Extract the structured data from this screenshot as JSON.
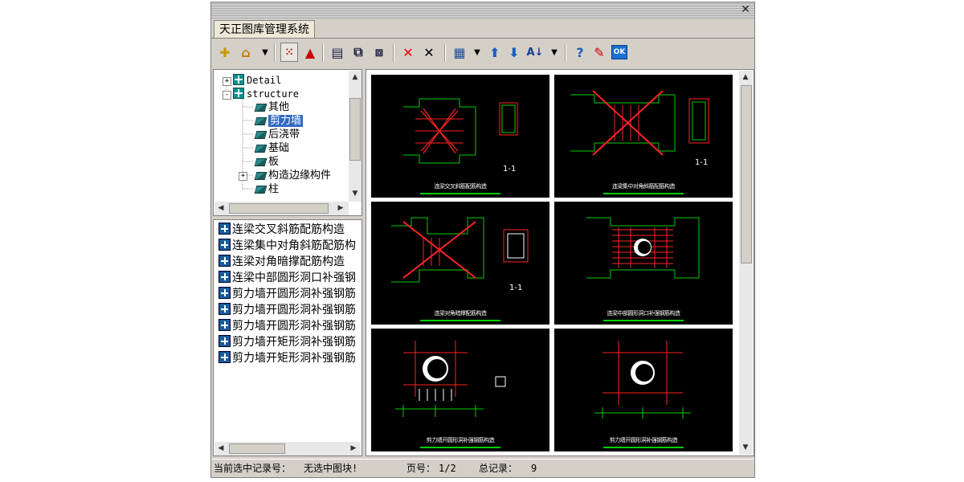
{
  "window": {
    "close_glyph": "✕",
    "tab_title": "天正图库管理系统"
  },
  "toolbar": {
    "icons": [
      "new-library-icon",
      "open-library-icon",
      "dropdown-arrow-icon",
      "select-all-icon",
      "triangle-view-icon",
      "list-view-icon",
      "export-icon",
      "import-icon",
      "delete-red-icon",
      "delete-black-icon",
      "grid-layout-icon",
      "dropdown-arrow-icon",
      "move-up-icon",
      "move-down-icon",
      "sort-az-icon",
      "dropdown-arrow-icon",
      "help-icon",
      "edit-icon",
      "ok-icon"
    ],
    "ok_label": "OK"
  },
  "tree": {
    "items": [
      {
        "label": "Detail",
        "level": 0,
        "expander": "+",
        "icon": "structure-icon"
      },
      {
        "label": "structure",
        "level": 0,
        "expander": "-",
        "icon": "structure-icon"
      },
      {
        "label": "其他",
        "level": 1,
        "icon": "book-icon"
      },
      {
        "label": "剪力墙",
        "level": 1,
        "icon": "open-book-icon",
        "selected": true
      },
      {
        "label": "后浇带",
        "level": 1,
        "icon": "book-icon"
      },
      {
        "label": "基础",
        "level": 1,
        "icon": "book-icon"
      },
      {
        "label": "板",
        "level": 1,
        "icon": "book-icon"
      },
      {
        "label": "构造边缘构件",
        "level": 1,
        "expander": "+",
        "icon": "book-icon"
      },
      {
        "label": "柱",
        "level": 1,
        "icon": "book-icon"
      }
    ]
  },
  "list": {
    "items": [
      "连梁交叉斜筋配筋构造",
      "连梁集中对角斜筋配筋构",
      "连梁对角暗撑配筋构造",
      "连梁中部圆形洞口补强钢",
      "剪力墙开圆形洞补强钢筋",
      "剪力墙开圆形洞补强钢筋",
      "剪力墙开圆形洞补强钢筋",
      "剪力墙开矩形洞补强钢筋",
      "剪力墙开矩形洞补强钢筋"
    ]
  },
  "preview": {
    "thumbnails": [
      {
        "caption": "连梁交叉斜筋配筋构造",
        "section_label": "1-1"
      },
      {
        "caption": "连梁集中对角斜筋配筋构造",
        "section_label": "1-1"
      },
      {
        "caption": "连梁对角暗撑配筋构造",
        "section_label": "1-1"
      },
      {
        "caption": "连梁中部圆形洞口补强钢筋构造",
        "section_label": ""
      },
      {
        "caption": "剪力墙开圆形洞补强钢筋构造",
        "section_label": ""
      },
      {
        "caption": "剪力墙开圆形洞补强钢筋构造",
        "section_label": ""
      }
    ],
    "colors": {
      "bg": "#000000",
      "red": "#ff2020",
      "green": "#00e000",
      "white": "#ffffff",
      "yellow": "#ffff00"
    }
  },
  "status": {
    "current_label": "当前选中记录号：",
    "current_value": "无选中图块!",
    "page_label": "页号：",
    "page_value": "1/2",
    "total_label": "总记录：",
    "total_value": "9"
  }
}
